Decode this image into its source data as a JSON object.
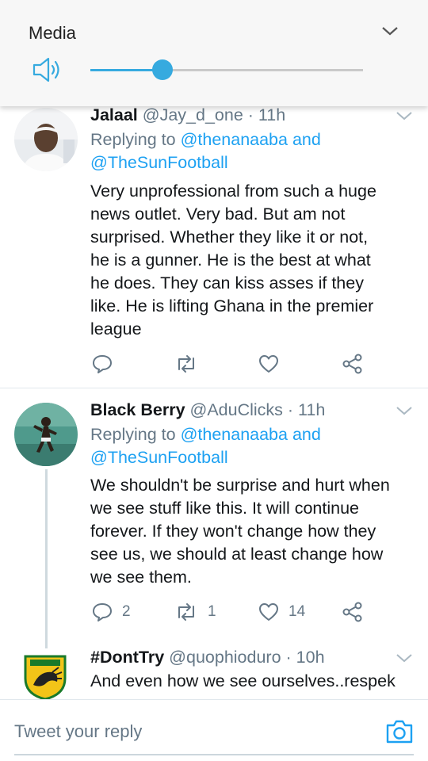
{
  "media_panel": {
    "title": "Media",
    "volume_fraction": 0.265
  },
  "tweets": [
    {
      "name": "Jalaal",
      "handle": "@Jay_d_one",
      "time": "· 11h",
      "replying_prefix": "Replying to",
      "replying_to_1": "@thenanaaba and",
      "replying_to_2": "@TheSunFootball",
      "text_lines": [
        "Very unprofessional from such a huge",
        "news outlet. Very bad. But am not",
        "surprised. Whether they like it or not,",
        "he is a gunner. He is the best at what",
        "he does. They can kiss asses if they",
        "like. He is lifting Ghana in the premier",
        "league"
      ],
      "reply_count": "",
      "retweet_count": "",
      "like_count": ""
    },
    {
      "name": "Black Berry",
      "handle": "@AduClicks",
      "time": "· 11h",
      "replying_prefix": "Replying to",
      "replying_to_1": "@thenanaaba and",
      "replying_to_2": "@TheSunFootball",
      "text_lines": [
        "We shouldn't be surprise and hurt when",
        "we see stuff like this. It will continue",
        "forever. If they won't change how they",
        "see us, we should at least change how",
        "we see them."
      ],
      "reply_count": "2",
      "retweet_count": "1",
      "like_count": "14"
    },
    {
      "name": "#DontTry",
      "handle": "@quophioduro",
      "time": "· 10h",
      "text_lines": [
        "And even how we see ourselves..respek"
      ]
    }
  ],
  "reply_bar": {
    "placeholder": "Tweet your reply"
  },
  "icons": {
    "accent": "#1da1f2",
    "slider": "#36aadf",
    "muted": "#657786"
  }
}
